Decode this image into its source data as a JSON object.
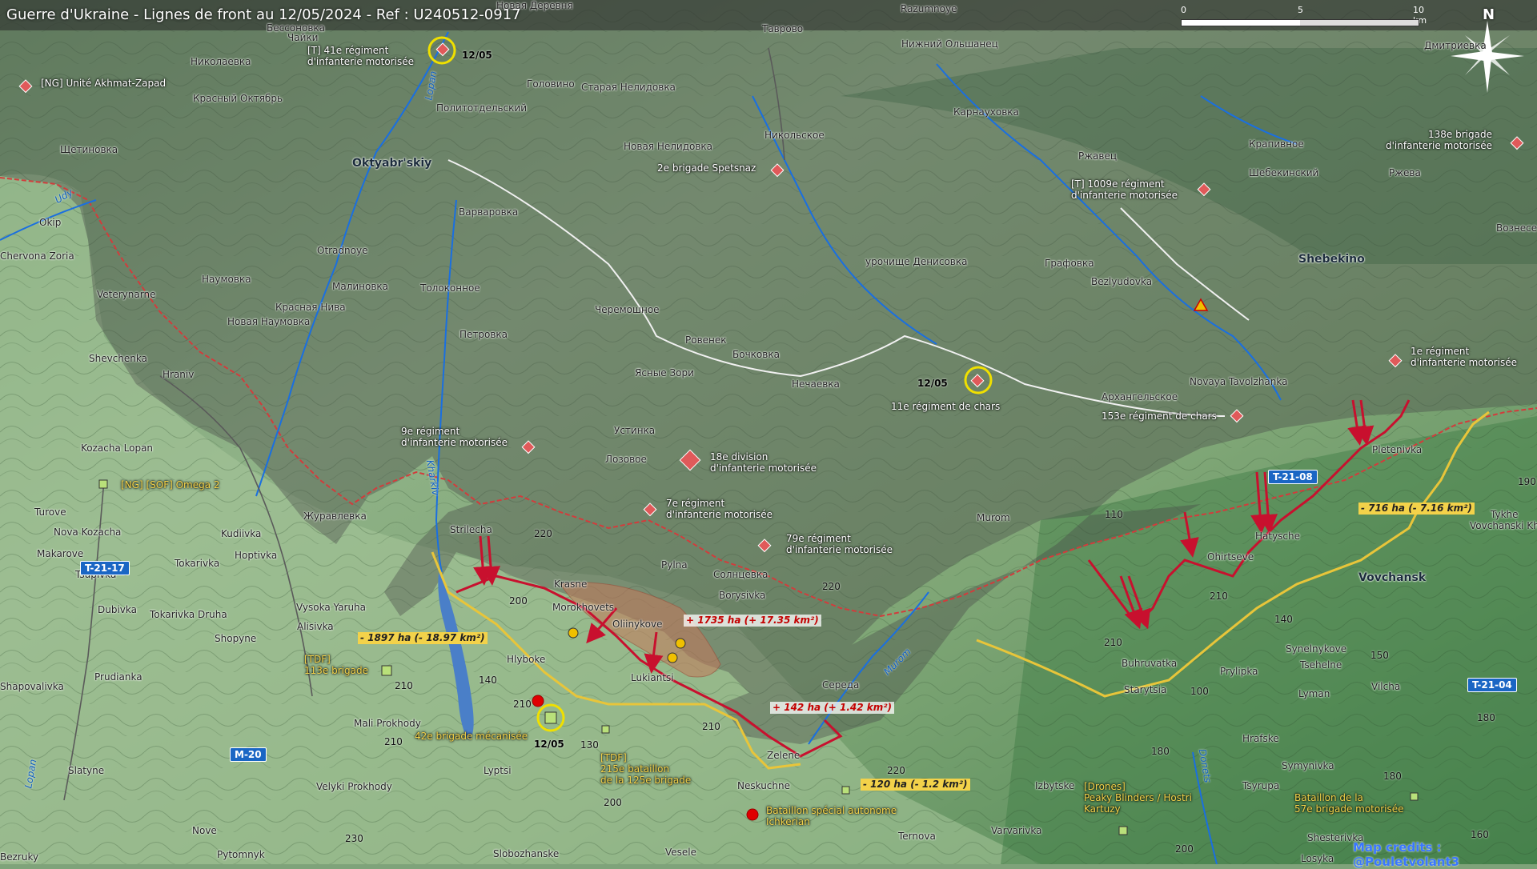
{
  "title": "Guerre d'Ukraine - Lignes de front au 12/05/2024 - Ref : U240512-0917",
  "scale": {
    "ticks": [
      "0",
      "5",
      "10 km"
    ]
  },
  "north_label": "N",
  "credits": "Map credits : @Pouletvolant3",
  "colors": {
    "ru_front": "#c8102e",
    "ua_front": "#e8c53a",
    "ru_zone": "#5a5a5a",
    "border": "#d23c3c",
    "river": "#1a6fe0",
    "road_badge": "#1a66c4"
  },
  "places": {
    "oktyabrskiy": "Oktyabr'skiy",
    "shebekino": "Shebekino",
    "vovchansk": "Vovchansk",
    "razumnoye": "Razumnoye",
    "chaiki": "Чайки",
    "nikolaevka": "Николаевка",
    "krasny_oktyabr": "Красный Октябрь",
    "politotdelsky": "Политотдельский",
    "golovino": "Головино",
    "staraya_nelidovka": "Старая Нелидовка",
    "shchetinovka": "Щетиновка",
    "novaya_nelidovka": "Новая Нелидовка",
    "nikolskoe": "Никольское",
    "tavrovo": "Таврово",
    "nizh_olshanets": "Нижний Ольшанец",
    "karnaukhovka": "Карнауховка",
    "rzhavets": "Ржавец",
    "krapivnoe": "Крапивное",
    "shebekinsky": "Шебекинский",
    "rzheva": "Ржева",
    "dmitrievka": "Дмитриевка",
    "vozneseno": "Вознесе",
    "varvarovka": "Варваровка",
    "okip": "Okip",
    "chervona_zoria": "Chervona Zoria",
    "otradnoye": "Otradnoye",
    "malinovka": "Малиновка",
    "naumovka": "Наумовка",
    "krasnaya_niva": "Красная Нива",
    "tolokonnoe": "Толоконное",
    "nova_naumovka": "Новая Наумовка",
    "veterynarne": "Veterynarne",
    "cheremoshnoe": "Черемошное",
    "urochishche": "урочище Денисовка",
    "grafovka": "Графовка",
    "bezlyudovka": "Bezlyudovka",
    "petrovka": "Петровка",
    "rovenek": "Ровенек",
    "bochkovka": "Бочковка",
    "shevchenka": "Shevchenka",
    "hraniv": "Hraniv",
    "yasnye_zori": "Ясные Зори",
    "nechaevka": "Нечаевка",
    "arkhangelskoe": "Архангельское",
    "novaya_tavolzhanka": "Novaya Tavolzhanka",
    "kozacha_lopan": "Kozacha Lopan",
    "ustinka": "Устинка",
    "lozovoe": "Лозовое",
    "pletenivka": "Pletenivka",
    "turove": "Turove",
    "nova_kozacha": "Nova Kozacha",
    "zhuravlevka": "Журавлевка",
    "strilecha": "Strilecha",
    "makarove": "Makarove",
    "hatysche": "Hatysche",
    "tykhe": "Tykhe",
    "vovchanski_khu": "Vovchanski Khu",
    "murom": "Murom",
    "ohirtseve": "Ohirtseve",
    "kudiivka": "Kudiivka",
    "tsupivka": "Tsupivka",
    "tokarivka": "Tokarivka",
    "hoptivka": "Hoptivka",
    "krasne": "Krasne",
    "pylna": "Pylna",
    "solntsevka": "Солнцевка",
    "borysivka": "Borysivka",
    "dubivka": "Dubivka",
    "tokarivka_druha": "Tokarivka Druha",
    "vysoka_yaruha": "Vysoka Yaruha",
    "alisivka": "Alisivka",
    "morokhovets": "Morokhovets",
    "oliinykove": "Oliinykove",
    "shopyne": "Shopyne",
    "hlyboke": "Hlyboke",
    "synelnykove": "Synelnykove",
    "tsehelne": "Tsehelne",
    "shapovalivka": "Shapovalivka",
    "prudianka": "Prudianka",
    "lukiantsi": "Lukiantsi",
    "sereda": "Середа",
    "buhruvatka": "Buhruvatka",
    "prylipka": "Prylipka",
    "starytsia": "Starytsia",
    "lyman": "Lyman",
    "vilcha": "Vilcha",
    "mali_prokhody": "Mali Prokhody",
    "zelene": "Zelene",
    "hrafske": "Hrafske",
    "symynivka": "Symynivka",
    "slatyne": "Slatyne",
    "lyptsi": "Lyptsi",
    "neskuchne": "Neskuchne",
    "velyki_prokhody": "Velyki Prokhody",
    "izbytske": "Izbytske",
    "tsyrupa": "Tsyrupa",
    "nove": "Nove",
    "ternova": "Ternova",
    "varvarivka": "Varvarivka",
    "shesterivka": "Shesterivka",
    "pytomnyk": "Pytomnyk",
    "slobozhanske": "Slobozhanske",
    "vesele": "Vesele",
    "bezruky": "Bezruky",
    "losyka": "Losyka",
    "besonovka": "Бессоновка",
    "nova_derevnya": "Новая Деревня"
  },
  "rivers": {
    "lopan": "Lopan",
    "udy": "Udy",
    "kharkiv": "Kharkiv",
    "murom": "Murom",
    "donets": "Donets"
  },
  "elevations": [
    "220",
    "200",
    "220",
    "210",
    "140",
    "210",
    "210",
    "130",
    "210",
    "200",
    "220",
    "210",
    "210",
    "140",
    "150",
    "100",
    "110",
    "190",
    "180",
    "180",
    "160",
    "230",
    "200",
    "180"
  ],
  "roads": {
    "t2117": "T-21-17",
    "m20": "M-20",
    "t2108": "T-21-08",
    "t2104": "T-21-04"
  },
  "units": {
    "akhmat": "[NG] Unité Akhmat-Zapad",
    "r41_l1": "[T] 41e régiment",
    "r41_l2": "d'infanterie motorisée",
    "spetsnaz": "2e brigade Spetsnaz",
    "r1009_l1": "[T] 1009e régiment",
    "r1009_l2": "d'infanterie motorisée",
    "b138_l1": "138e brigade",
    "b138_l2": "d'infanterie motorisée",
    "r1_l1": "1e régiment",
    "r1_l2": "d'infanterie motorisée",
    "r11": "11e régiment de chars",
    "r153": "153e régiment de chars",
    "r9_l1": "9e régiment",
    "r9_l2": "d'infanterie motorisée",
    "d18_l1": "18e division",
    "d18_l2": "d'infanterie motorisée",
    "r7_l1": "7e régiment",
    "r7_l2": "d'infanterie motorisée",
    "r79_l1": "79e régiment",
    "r79_l2": "d'infanterie motorisée",
    "omega": "[NG] [SOF] Omega 2",
    "tdf113_l1": "[TDF]",
    "tdf113_l2": "113e brigade",
    "b42": "42e brigade mécanisée",
    "tdf215_l1": "[TDF]",
    "tdf215_l2": "215e bataillon",
    "tdf215_l3": "de la 125e brigade",
    "ichkerian_l1": "Bataillon spécial autonome",
    "ichkerian_l2": "Ichkerian",
    "drones_l1": "[Drones]",
    "drones_l2": "Peaky Blinders / Hostri",
    "drones_l3": "Kartuzy",
    "b57_l1": "Bataillon de la",
    "b57_l2": "57e brigade motorisée"
  },
  "areas": {
    "ru1": "+ 1735 ha (+ 17.35 km²)",
    "ru2": "+ 142 ha (+ 1.42 km²)",
    "ua1": "- 1897 ha (- 18.97 km²)",
    "ua2": "- 120 ha (- 1.2 km²)",
    "ua3": "- 716 ha (- 7.16 km²)"
  },
  "dates": {
    "d1": "12/05",
    "d2": "12/05",
    "d3": "12/05"
  }
}
